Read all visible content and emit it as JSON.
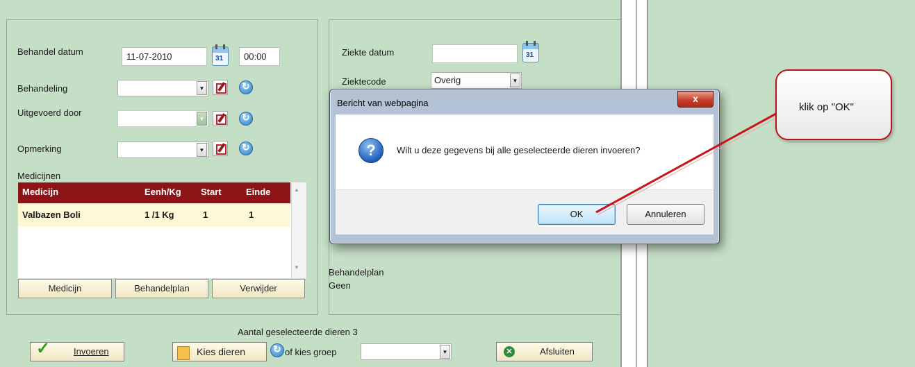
{
  "form": {
    "behandel_datum_label": "Behandel datum",
    "behandel_datum_value": "11-07-2010",
    "time_value": "00:00",
    "behandeling_label": "Behandeling",
    "uitgevoerd_door_label": "Uitgevoerd door",
    "opmerking_label": "Opmerking",
    "medicijnen_label": "Medicijnen"
  },
  "calendar_icon_text": "31",
  "medicine_table": {
    "headers": [
      "Medicijn",
      "Eenh/Kg",
      "Start",
      "Einde"
    ],
    "rows": [
      {
        "medicijn": "Valbazen Boli",
        "eenh": "1 /1 Kg",
        "start": "1",
        "einde": "1"
      }
    ]
  },
  "buttons": {
    "medicijn": "Medicijn",
    "behandelplan": "Behandelplan",
    "verwijder": "Verwijder"
  },
  "right_form": {
    "ziekte_datum_label": "Ziekte datum",
    "ziektecode_label": "Ziektecode",
    "ziektecode_value": "Overig",
    "behandelplan_label": "Behandelplan",
    "behandelplan_value": "Geen"
  },
  "footer": {
    "aantal_label": "Aantal geselecteerde dieren 3",
    "invoeren": "Invoeren",
    "kies_dieren": "Kies dieren",
    "of_kies_groep": "of kies groep",
    "afsluiten": "Afsluiten"
  },
  "dialog": {
    "title": "Bericht van webpagina",
    "close_symbol": "x",
    "question_symbol": "?",
    "message": "Wilt u deze gegevens bij alle geselecteerde dieren invoeren?",
    "ok": "OK",
    "cancel": "Annuleren"
  },
  "callout": {
    "text": "klik op \"OK\""
  },
  "colors": {
    "background": "#c5dec6",
    "table_header": "#8d1416",
    "table_row": "#fdf8d6",
    "callout_border": "#b8141a",
    "callout_line": "#c8151b"
  }
}
